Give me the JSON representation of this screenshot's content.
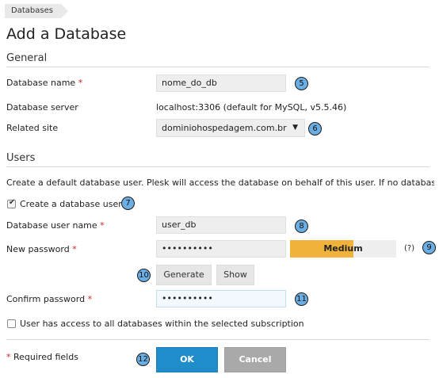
{
  "breadcrumb": {
    "label": "Databases"
  },
  "page": {
    "title": "Add a Database"
  },
  "general": {
    "section_title": "General",
    "db_name": {
      "label": "Database name",
      "required_mark": "*",
      "value": "nome_do_db"
    },
    "db_server": {
      "label": "Database server",
      "value": "localhost:3306 (default for MySQL, v5.5.46)"
    },
    "related_site": {
      "label": "Related site",
      "value": "dominiohospedagem.com.br",
      "caret": "▼"
    }
  },
  "users": {
    "section_title": "Users",
    "description": "Create a default database user. Plesk will access the database on behalf of this user. If no database",
    "create_user": {
      "label": "Create a database user",
      "checked": true,
      "tick": "✔"
    },
    "username": {
      "label": "Database user name",
      "required_mark": "*",
      "value": "user_db"
    },
    "password": {
      "label": "New password",
      "required_mark": "*",
      "value": "••••••••••"
    },
    "strength": {
      "label": "Medium",
      "level": 0.6,
      "color": "#f0b23a"
    },
    "help": "(?)",
    "generate_label": "Generate",
    "show_label": "Show",
    "confirm": {
      "label": "Confirm password",
      "required_mark": "*",
      "value": "••••••••••"
    },
    "all_dbs": {
      "label": "User has access to all databases within the selected subscription",
      "checked": false
    }
  },
  "footer": {
    "required_note": "* Required fields",
    "ok_label": "OK",
    "cancel_label": "Cancel"
  },
  "badges": [
    "5",
    "6",
    "7",
    "8",
    "9",
    "10",
    "11",
    "12"
  ],
  "colors": {
    "primary": "#1f8dc9",
    "badge": "#6aaee3",
    "required": "#d32323",
    "strength": "#f0b23a"
  }
}
